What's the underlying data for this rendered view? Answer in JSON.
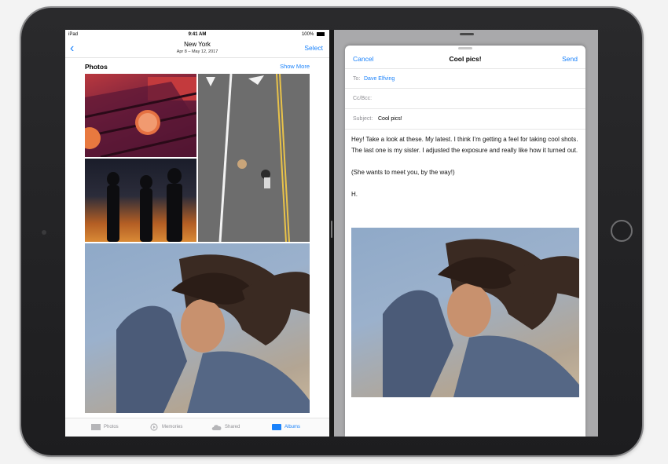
{
  "photos_app": {
    "status": {
      "device": "iPad",
      "time": "9:41 AM",
      "battery": "100%"
    },
    "nav": {
      "title": "New York",
      "subtitle": "Apr 8 – May 12, 2017",
      "select": "Select"
    },
    "section": {
      "title": "Photos",
      "show_more": "Show More"
    },
    "tabs": [
      {
        "label": "Photos"
      },
      {
        "label": "Memories"
      },
      {
        "label": "Shared"
      },
      {
        "label": "Albums"
      }
    ],
    "active_tab": "Albums",
    "accent": "#1a82fb"
  },
  "mail_compose": {
    "cancel": "Cancel",
    "title": "Cool pics!",
    "send": "Send",
    "to_label": "To:",
    "to_value": "Dave Elfving",
    "cc_label": "Cc/Bcc:",
    "subject_label": "Subject:",
    "subject_value": "Cool pics!",
    "body": [
      "Hey! Take a look at these. My latest. I think I’m getting a feel for taking cool shots. The last one is my sister. I adjusted the exposure and really like how it turned out.",
      "(She wants to meet you, by the way!)",
      "H."
    ]
  }
}
